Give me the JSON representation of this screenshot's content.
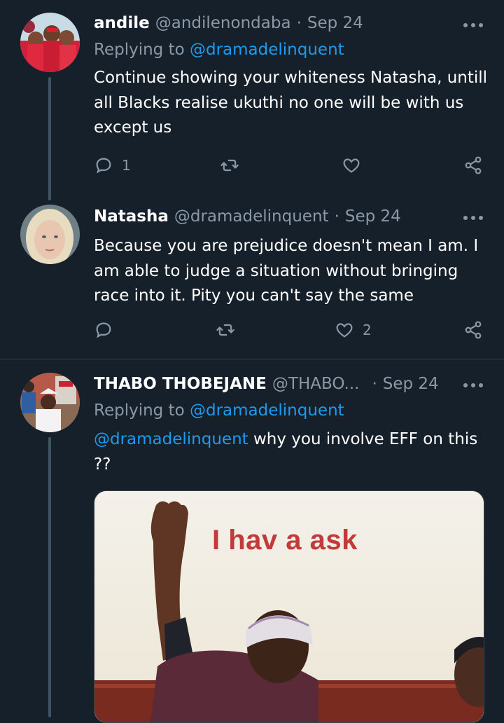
{
  "tweets": [
    {
      "name": "andile",
      "handle": "@andilenondaba",
      "date": "Sep 24",
      "replying_label": "Replying to",
      "replying_handle": "@dramadelinquent",
      "text": "Continue showing your whiteness Natasha, untill all Blacks realise ukuthi no one will be with us except us",
      "reply_count": "1",
      "retweet_count": "",
      "like_count": ""
    },
    {
      "name": "Natasha",
      "handle": "@dramadelinquent",
      "date": "Sep 24",
      "text": "Because you are prejudice doesn't mean I am. I am able to judge a situation without bringing race into it. Pity you can't say the same",
      "reply_count": "",
      "retweet_count": "",
      "like_count": "2"
    },
    {
      "name": "THABO THOBEJANE",
      "handle": "@THABO...",
      "date": "Sep 24",
      "replying_label": "Replying to",
      "replying_handle": "@dramadelinquent",
      "mention": "@dramadelinquent",
      "text": " why you involve EFF on  this ??",
      "media_caption": "I hav a ask"
    }
  ],
  "separator": "·",
  "icons": {
    "reply": "reply-icon",
    "retweet": "retweet-icon",
    "like": "heart-icon",
    "share": "share-icon",
    "more": "more-icon"
  },
  "colors": {
    "background": "#15202b",
    "secondary_text": "#8b98a5",
    "link": "#1d9bf0",
    "divider": "#38444d"
  }
}
